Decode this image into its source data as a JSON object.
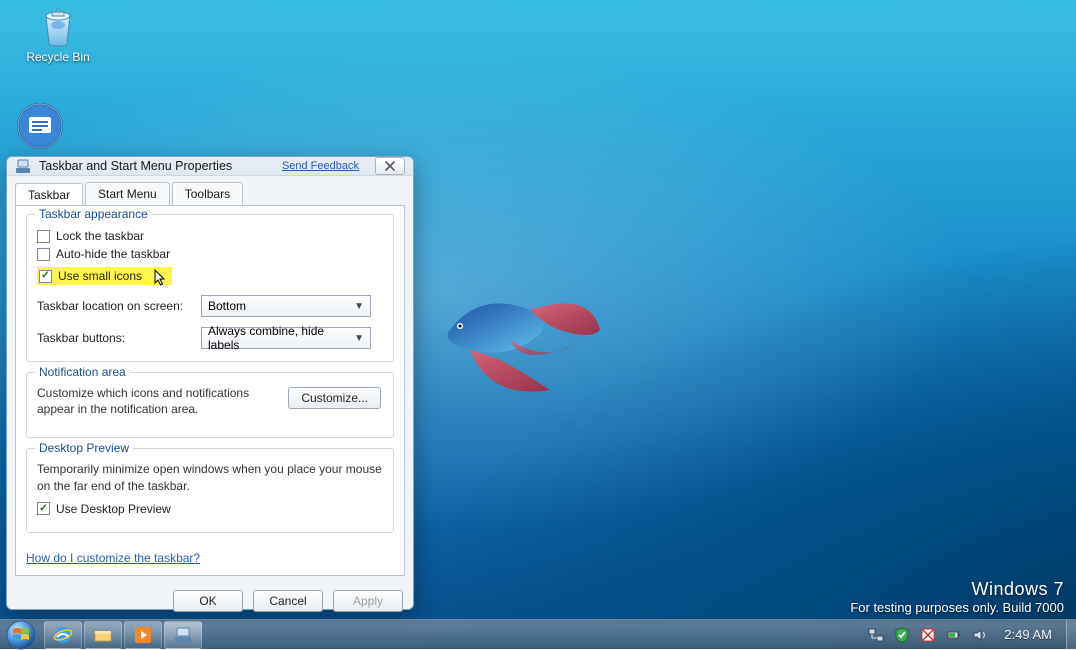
{
  "desktop": {
    "recycle_bin_label": "Recycle Bin"
  },
  "watermark": {
    "line1": "Windows  7",
    "line2": "For testing purposes only. Build 7000"
  },
  "window": {
    "title": "Taskbar and Start Menu Properties",
    "feedback_link": "Send Feedback",
    "tabs": {
      "taskbar": "Taskbar",
      "startmenu": "Start Menu",
      "toolbars": "Toolbars"
    },
    "appearance": {
      "legend": "Taskbar appearance",
      "lock": "Lock the taskbar",
      "autohide": "Auto-hide the taskbar",
      "smallicons": "Use small icons",
      "location_label": "Taskbar location on screen:",
      "location_value": "Bottom",
      "buttons_label": "Taskbar buttons:",
      "buttons_value": "Always combine, hide labels"
    },
    "notification": {
      "legend": "Notification area",
      "text": "Customize which icons and notifications appear in the notification area.",
      "button": "Customize..."
    },
    "preview": {
      "legend": "Desktop Preview",
      "text": "Temporarily minimize open windows when you place your mouse on the far end of the taskbar.",
      "checkbox": "Use Desktop Preview"
    },
    "help_link": "How do I customize the taskbar?",
    "buttons": {
      "ok": "OK",
      "cancel": "Cancel",
      "apply": "Apply"
    }
  },
  "taskbar": {
    "clock": "2:49 AM"
  }
}
